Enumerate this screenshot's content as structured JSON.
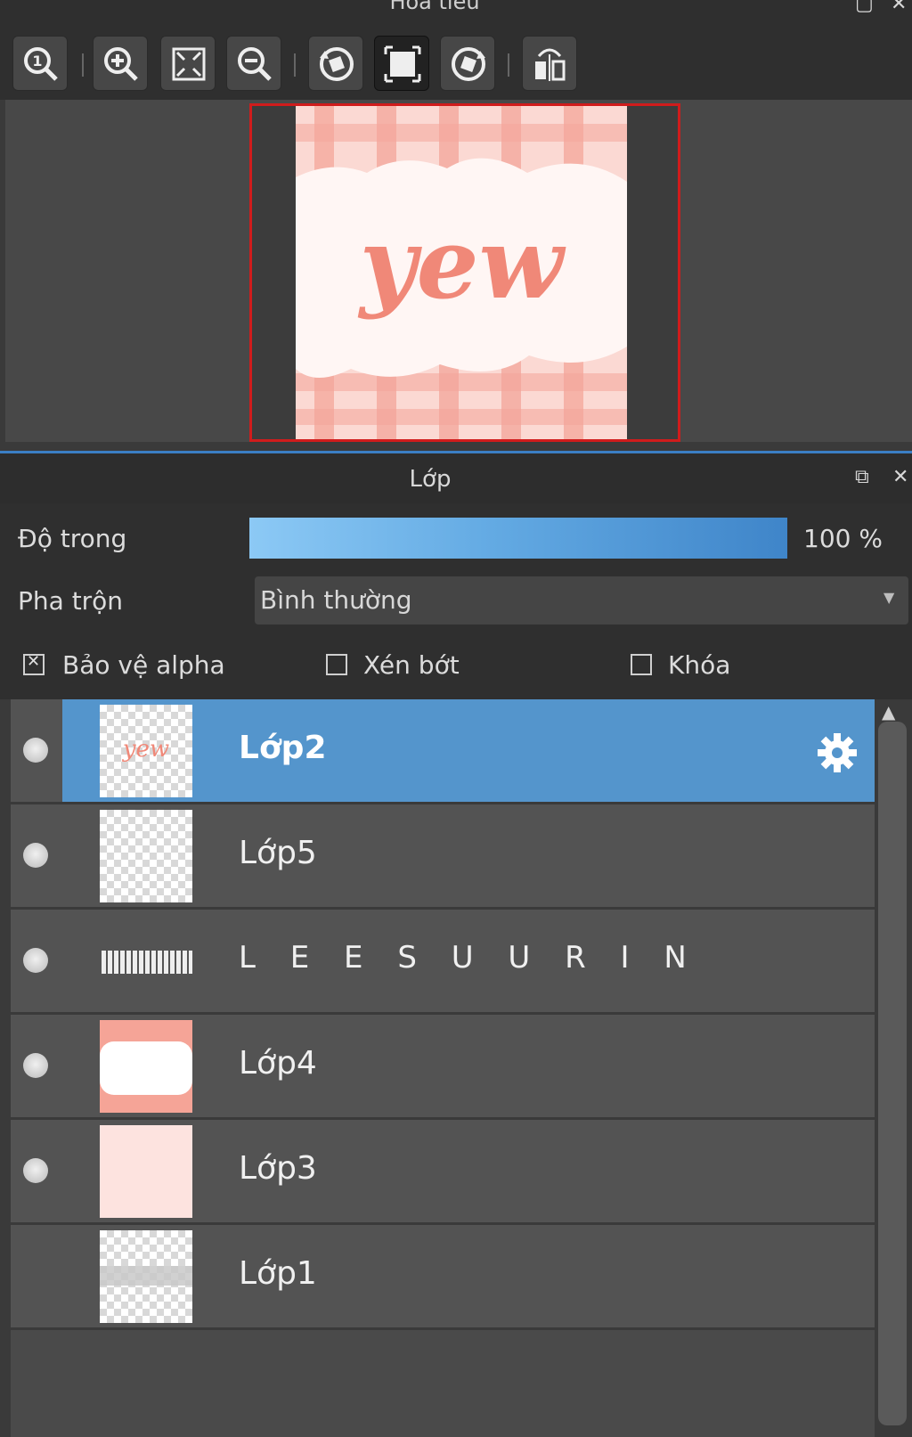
{
  "navigator": {
    "title": "Hoa tieu",
    "toolbar": [
      {
        "icon": "zoom-actual-size-icon"
      },
      {
        "icon": "zoom-in-icon"
      },
      {
        "icon": "fit-screen-icon"
      },
      {
        "icon": "zoom-out-icon"
      },
      {
        "icon": "rotate-left-icon"
      },
      {
        "icon": "reset-view-icon",
        "active": true
      },
      {
        "icon": "rotate-right-icon"
      },
      {
        "icon": "flip-horizontal-icon"
      }
    ],
    "preview": {
      "text": "yew",
      "colors": {
        "frame": "#d01c1c",
        "plaid": "#f4a59a",
        "cloud": "#fff6f4",
        "text": "#f08878"
      }
    }
  },
  "layers_panel": {
    "title": "Lớp",
    "opacity_label": "Độ trong",
    "opacity_value": "100 %",
    "opacity_fraction": 1.0,
    "blend_label": "Pha trộn",
    "blend_value": "Bình thường",
    "checkboxes": [
      {
        "label": "Bảo vệ alpha",
        "checked": true
      },
      {
        "label": "Xén bớt",
        "checked": false
      },
      {
        "label": "Khóa",
        "checked": false
      }
    ],
    "layers": [
      {
        "name": "Lớp2",
        "visible": true,
        "selected": true
      },
      {
        "name": "Lớp5",
        "visible": true,
        "selected": false
      },
      {
        "name": "L E E S U U R I N",
        "visible": true,
        "selected": false
      },
      {
        "name": "Lớp4",
        "visible": true,
        "selected": false
      },
      {
        "name": "Lớp3",
        "visible": true,
        "selected": false
      },
      {
        "name": "Lớp1",
        "visible": false,
        "selected": false
      }
    ],
    "accent_color": "#5495cc"
  }
}
